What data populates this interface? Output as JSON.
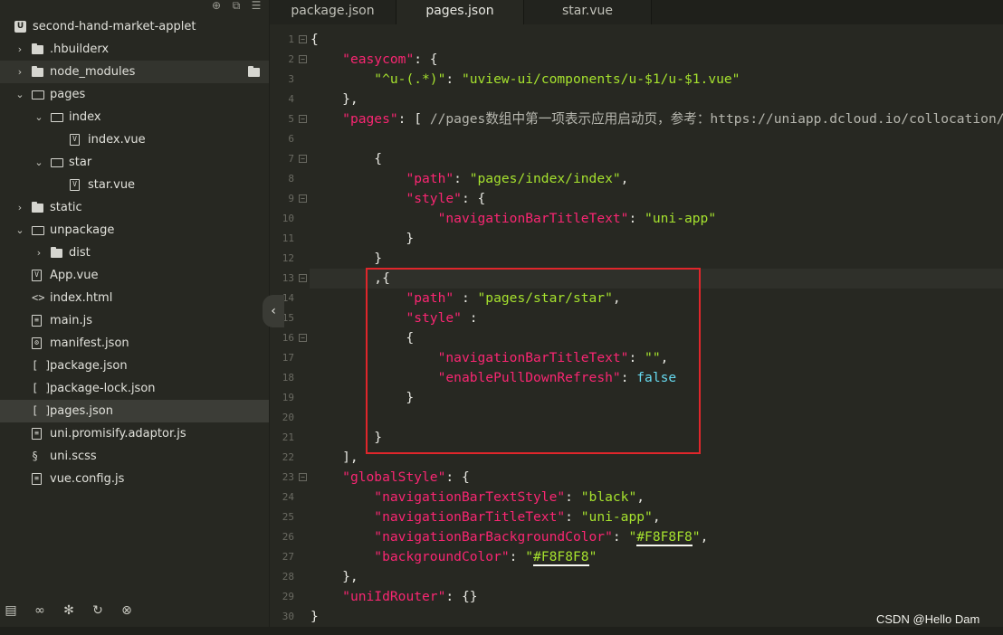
{
  "sidebar": {
    "top_icons": [
      "target-icon",
      "copy-icon",
      "menu-icon"
    ],
    "items": [
      {
        "label": "second-hand-market-applet",
        "type": "root"
      },
      {
        "label": ".hbuilderx",
        "type": "folder"
      },
      {
        "label": "node_modules",
        "type": "folder"
      },
      {
        "label": "pages",
        "type": "folder-open"
      },
      {
        "label": "index",
        "type": "folder-open"
      },
      {
        "label": "index.vue",
        "type": "vue"
      },
      {
        "label": "star",
        "type": "folder-open"
      },
      {
        "label": "star.vue",
        "type": "vue"
      },
      {
        "label": "static",
        "type": "folder"
      },
      {
        "label": "unpackage",
        "type": "folder-open"
      },
      {
        "label": "dist",
        "type": "folder"
      },
      {
        "label": "App.vue",
        "type": "vue"
      },
      {
        "label": "index.html",
        "type": "html"
      },
      {
        "label": "main.js",
        "type": "js"
      },
      {
        "label": "manifest.json",
        "type": "manifest"
      },
      {
        "label": "package.json",
        "type": "json"
      },
      {
        "label": "package-lock.json",
        "type": "json"
      },
      {
        "label": "pages.json",
        "type": "json"
      },
      {
        "label": "uni.promisify.adaptor.js",
        "type": "js"
      },
      {
        "label": "uni.scss",
        "type": "scss"
      },
      {
        "label": "vue.config.js",
        "type": "js"
      }
    ],
    "bottom_icons": [
      "files-icon",
      "binoculars-icon",
      "bug-icon",
      "refresh-icon",
      "globe-icon"
    ],
    "collapse_glyph": "‹"
  },
  "tabs": [
    {
      "label": "package.json"
    },
    {
      "label": "pages.json"
    },
    {
      "label": "star.vue"
    }
  ],
  "editor": {
    "line_numbers": [
      "1",
      "2",
      "3",
      "4",
      "5",
      "6",
      "7",
      "8",
      "9",
      "10",
      "11",
      "12",
      "13",
      "14",
      "15",
      "16",
      "17",
      "18",
      "19",
      "20",
      "21",
      "22",
      "23",
      "24",
      "25",
      "26",
      "27",
      "28",
      "29",
      "30"
    ],
    "lines": [
      {
        "t": [
          [
            "p",
            "{"
          ]
        ]
      },
      {
        "t": [
          [
            "p",
            "    "
          ],
          [
            "k",
            "\"easycom\""
          ],
          [
            "p",
            ": {"
          ]
        ]
      },
      {
        "t": [
          [
            "p",
            "        "
          ],
          [
            "s",
            "\"^u-(.*)\""
          ],
          [
            "p",
            ": "
          ],
          [
            "s",
            "\"uview-ui/components/u-$1/u-$1.vue\""
          ]
        ]
      },
      {
        "t": [
          [
            "p",
            "    },"
          ]
        ]
      },
      {
        "t": [
          [
            "p",
            "    "
          ],
          [
            "k",
            "\"pages\""
          ],
          [
            "p",
            ": [ "
          ],
          [
            "c",
            "//pages数组中第一项表示应用启动页，参考：https://uniapp.dcloud.io/collocation/pages"
          ]
        ]
      },
      {
        "t": [
          [
            "p",
            ""
          ]
        ]
      },
      {
        "t": [
          [
            "p",
            "        {"
          ]
        ]
      },
      {
        "t": [
          [
            "p",
            "            "
          ],
          [
            "k",
            "\"path\""
          ],
          [
            "p",
            ": "
          ],
          [
            "s",
            "\"pages/index/index\""
          ],
          [
            "p",
            ","
          ]
        ]
      },
      {
        "t": [
          [
            "p",
            "            "
          ],
          [
            "k",
            "\"style\""
          ],
          [
            "p",
            ": {"
          ]
        ]
      },
      {
        "t": [
          [
            "p",
            "                "
          ],
          [
            "k",
            "\"navigationBarTitleText\""
          ],
          [
            "p",
            ": "
          ],
          [
            "s",
            "\"uni-app\""
          ]
        ]
      },
      {
        "t": [
          [
            "p",
            "            }"
          ]
        ]
      },
      {
        "t": [
          [
            "p",
            "        }"
          ]
        ]
      },
      {
        "t": [
          [
            "p",
            "        ,{"
          ]
        ]
      },
      {
        "t": [
          [
            "p",
            "            "
          ],
          [
            "k",
            "\"path\""
          ],
          [
            "p",
            " : "
          ],
          [
            "s",
            "\"pages/star/star\""
          ],
          [
            "p",
            ","
          ]
        ]
      },
      {
        "t": [
          [
            "p",
            "            "
          ],
          [
            "k",
            "\"style\""
          ],
          [
            "p",
            " :"
          ]
        ]
      },
      {
        "t": [
          [
            "p",
            "            {"
          ]
        ]
      },
      {
        "t": [
          [
            "p",
            "                "
          ],
          [
            "k",
            "\"navigationBarTitleText\""
          ],
          [
            "p",
            ": "
          ],
          [
            "s",
            "\"\""
          ],
          [
            "p",
            ","
          ]
        ]
      },
      {
        "t": [
          [
            "p",
            "                "
          ],
          [
            "k",
            "\"enablePullDownRefresh\""
          ],
          [
            "p",
            ": "
          ],
          [
            "kw",
            "false"
          ]
        ]
      },
      {
        "t": [
          [
            "p",
            "            }"
          ]
        ]
      },
      {
        "t": [
          [
            "p",
            ""
          ]
        ]
      },
      {
        "t": [
          [
            "p",
            "        }"
          ]
        ]
      },
      {
        "t": [
          [
            "p",
            "    ],"
          ]
        ]
      },
      {
        "t": [
          [
            "p",
            "    "
          ],
          [
            "k",
            "\"globalStyle\""
          ],
          [
            "p",
            ": {"
          ]
        ]
      },
      {
        "t": [
          [
            "p",
            "        "
          ],
          [
            "k",
            "\"navigationBarTextStyle\""
          ],
          [
            "p",
            ": "
          ],
          [
            "s",
            "\"black\""
          ],
          [
            "p",
            ","
          ]
        ]
      },
      {
        "t": [
          [
            "p",
            "        "
          ],
          [
            "k",
            "\"navigationBarTitleText\""
          ],
          [
            "p",
            ": "
          ],
          [
            "s",
            "\"uni-app\""
          ],
          [
            "p",
            ","
          ]
        ]
      },
      {
        "t": [
          [
            "p",
            "        "
          ],
          [
            "k",
            "\"navigationBarBackgroundColor\""
          ],
          [
            "p",
            ": "
          ],
          [
            "s",
            "\""
          ],
          [
            "su",
            "#F8F8F8"
          ],
          [
            "s",
            "\""
          ],
          [
            "p",
            ","
          ]
        ]
      },
      {
        "t": [
          [
            "p",
            "        "
          ],
          [
            "k",
            "\"backgroundColor\""
          ],
          [
            "p",
            ": "
          ],
          [
            "s",
            "\""
          ],
          [
            "su",
            "#F8F8F8"
          ],
          [
            "s",
            "\""
          ]
        ]
      },
      {
        "t": [
          [
            "p",
            "    },"
          ]
        ]
      },
      {
        "t": [
          [
            "p",
            "    "
          ],
          [
            "k",
            "\"uniIdRouter\""
          ],
          [
            "p",
            ": {}"
          ]
        ]
      },
      {
        "t": [
          [
            "p",
            "}"
          ]
        ]
      }
    ],
    "foldable_lines": [
      1,
      2,
      5,
      7,
      9,
      13,
      16,
      23
    ]
  },
  "watermark": "CSDN @Hello Dam",
  "colors": {
    "background": "#272822",
    "key": "#f92672",
    "string": "#a6e22e",
    "keyword": "#66d9ef",
    "highlight_box": "#e0262b"
  }
}
